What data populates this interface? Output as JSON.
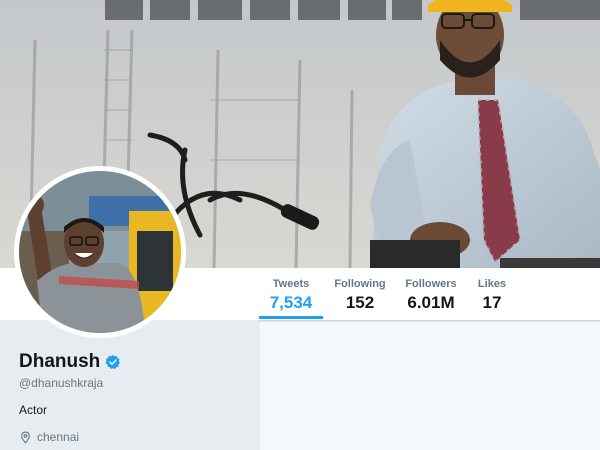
{
  "profile": {
    "name": "Dhanush",
    "handle": "@dhanushkraja",
    "bio": "Actor",
    "location": "chennai",
    "verified": true
  },
  "stats": [
    {
      "label": "Tweets",
      "value": "7,534",
      "active": true
    },
    {
      "label": "Following",
      "value": "152",
      "active": false
    },
    {
      "label": "Followers",
      "value": "6.01M",
      "active": false
    },
    {
      "label": "Likes",
      "value": "17",
      "active": false
    }
  ],
  "colors": {
    "accent": "#1da1f2",
    "text_primary": "#14171a",
    "text_secondary": "#657786",
    "page_bg": "#e6ecf0"
  },
  "icons": {
    "verified": "verified-badge-icon",
    "location": "location-pin-icon"
  }
}
